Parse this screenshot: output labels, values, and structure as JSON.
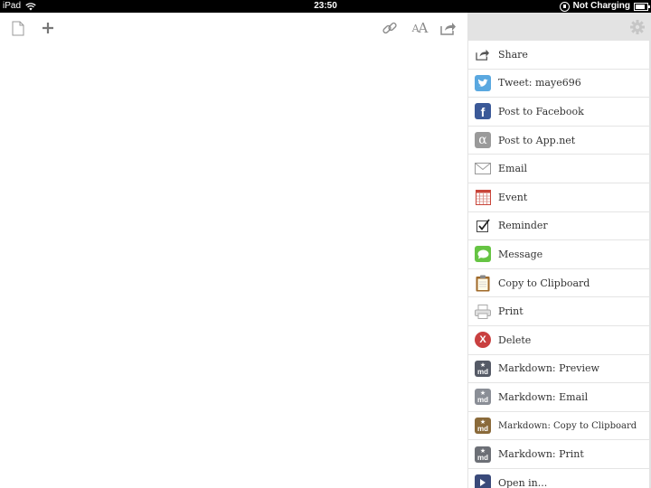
{
  "status": {
    "device": "iPad",
    "time": "23:50",
    "charging": "Not Charging"
  },
  "toolbar": {
    "new_document_icon": "document-icon",
    "add_icon": "plus-icon",
    "link_icon": "link-icon",
    "font_icon_small": "A",
    "font_icon_large": "A",
    "share_icon": "share-icon"
  },
  "panel": {
    "settings_icon": "gear-icon",
    "items": [
      {
        "label": "Share",
        "icon": "share-icon"
      },
      {
        "label": "Tweet: maye696",
        "icon": "twitter-icon"
      },
      {
        "label": "Post to Facebook",
        "icon": "facebook-icon"
      },
      {
        "label": "Post to App.net",
        "icon": "appnet-icon"
      },
      {
        "label": "Email",
        "icon": "envelope-icon"
      },
      {
        "label": "Event",
        "icon": "calendar-icon"
      },
      {
        "label": "Reminder",
        "icon": "checkbox-icon"
      },
      {
        "label": "Message",
        "icon": "message-icon"
      },
      {
        "label": "Copy to Clipboard",
        "icon": "clipboard-icon"
      },
      {
        "label": "Print",
        "icon": "printer-icon"
      },
      {
        "label": "Delete",
        "icon": "delete-icon"
      },
      {
        "label": "Markdown: Preview",
        "icon": "markdown-preview-icon"
      },
      {
        "label": "Markdown: Email",
        "icon": "markdown-email-icon"
      },
      {
        "label": "Markdown: Copy to Clipboard",
        "icon": "markdown-clipboard-icon"
      },
      {
        "label": "Markdown: Print",
        "icon": "markdown-print-icon"
      },
      {
        "label": "Open in...",
        "icon": "open-in-icon"
      }
    ]
  }
}
